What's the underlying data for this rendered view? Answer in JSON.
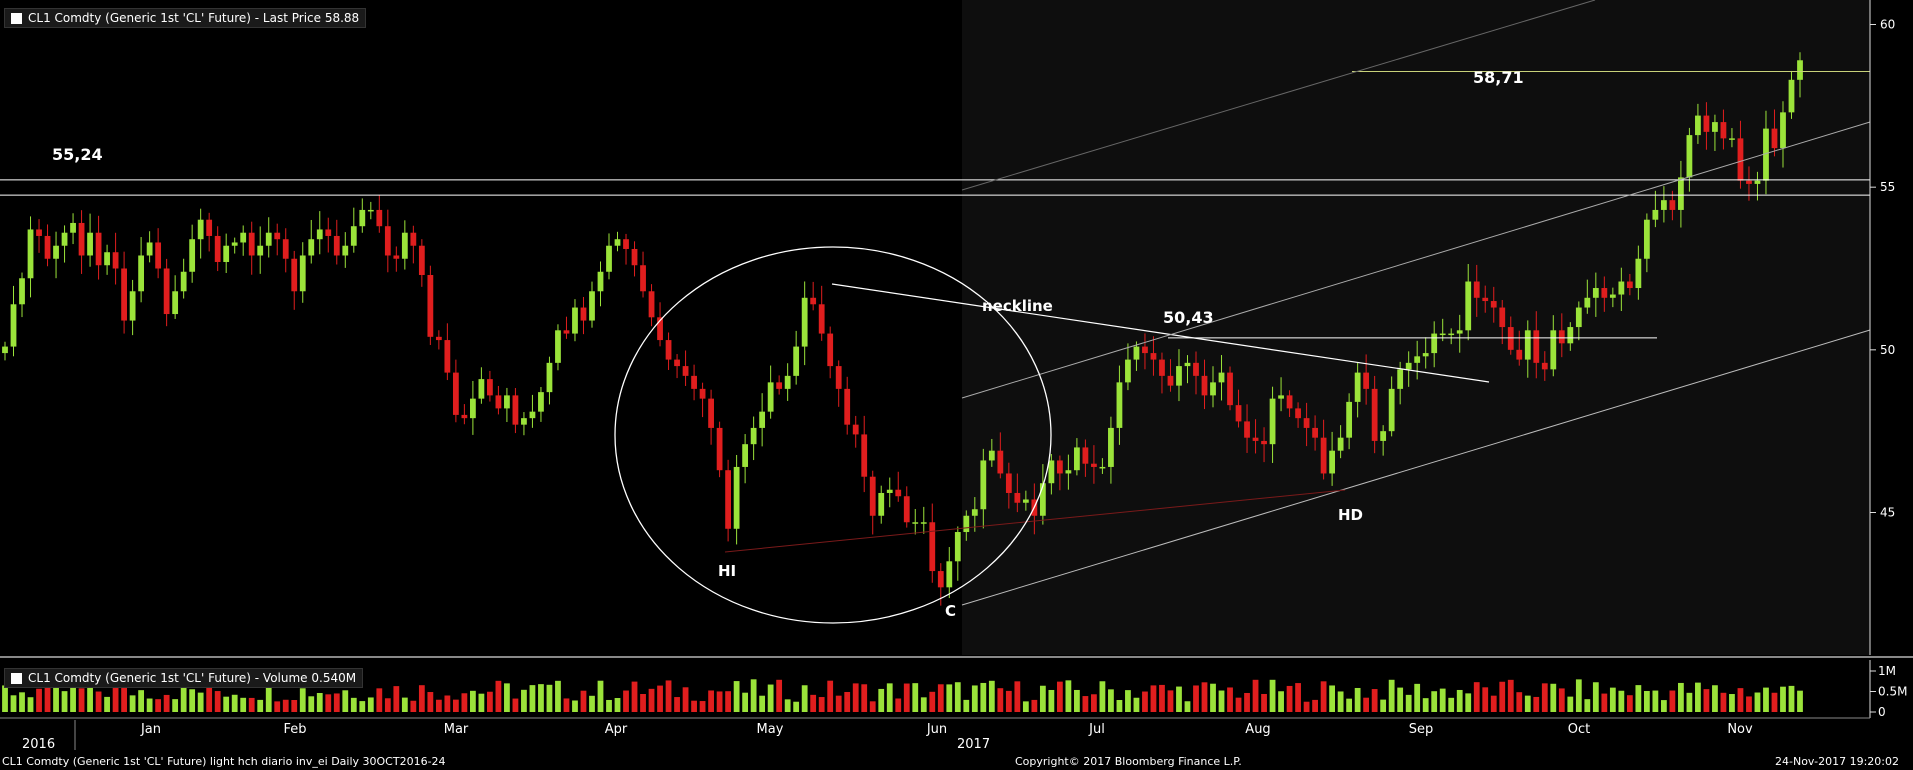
{
  "window": {
    "price_legend": "CL1 Comdty (Generic 1st 'CL' Future) - Last Price 58.88",
    "volume_legend": "CL1 Comdty (Generic 1st 'CL' Future) - Volume 0.540M",
    "footer_left": "CL1 Comdty (Generic 1st 'CL' Future) light hch diario inv_ei  Daily 30OCT2016-24",
    "footer_center": "Copyright© 2017 Bloomberg Finance L.P.",
    "footer_right": "24-Nov-2017 19:20:02"
  },
  "colors": {
    "up": "#9be33a",
    "down": "#e01e1e",
    "background": "#000000",
    "lines": "#ffffff",
    "resistance": "#c8d27a"
  },
  "chart_data": {
    "type": "candlestick",
    "y_ticks": [
      "60",
      "55",
      "50",
      "45"
    ],
    "ylim": [
      41.5,
      60.5
    ],
    "volume_ticks": [
      "1M",
      "0.5M",
      "0"
    ],
    "x_months": [
      "Jan",
      "Feb",
      "Mar",
      "Apr",
      "May",
      "Jun",
      "Jul",
      "Aug",
      "Sep",
      "Oct",
      "Nov"
    ],
    "years": [
      "2016",
      "2017"
    ],
    "closes": [
      50.1,
      51.4,
      52.2,
      53.7,
      53.5,
      52.8,
      53.2,
      53.6,
      53.9,
      52.9,
      53.6,
      52.6,
      53.0,
      52.5,
      50.9,
      51.8,
      52.9,
      53.3,
      52.5,
      51.1,
      51.8,
      52.4,
      53.4,
      54.0,
      53.5,
      52.7,
      53.2,
      53.3,
      53.6,
      52.9,
      53.2,
      53.6,
      53.4,
      52.8,
      51.8,
      52.9,
      53.4,
      53.7,
      53.5,
      52.9,
      53.2,
      53.8,
      54.3,
      54.3,
      53.8,
      52.9,
      52.8,
      53.6,
      53.2,
      52.3,
      50.4,
      50.3,
      49.3,
      48.0,
      47.9,
      48.5,
      49.1,
      48.6,
      48.2,
      48.6,
      47.7,
      47.9,
      48.1,
      48.7,
      49.6,
      50.6,
      50.5,
      51.3,
      50.9,
      51.8,
      52.4,
      53.2,
      53.4,
      53.1,
      52.6,
      51.8,
      51.0,
      50.3,
      49.7,
      49.5,
      49.2,
      48.8,
      48.5,
      47.6,
      46.3,
      44.5,
      46.4,
      47.1,
      47.6,
      48.1,
      49.0,
      48.8,
      49.2,
      50.1,
      51.6,
      51.4,
      50.5,
      49.5,
      48.8,
      47.7,
      47.4,
      46.1,
      44.9,
      45.6,
      45.7,
      45.5,
      44.7,
      44.7,
      44.7,
      43.2,
      42.7,
      43.5,
      44.4,
      44.9,
      45.1,
      46.6,
      46.9,
      46.2,
      45.6,
      45.3,
      45.4,
      44.9,
      45.9,
      46.6,
      46.2,
      46.3,
      47.0,
      46.5,
      46.4,
      46.4,
      47.6,
      49.0,
      49.7,
      50.1,
      49.9,
      49.7,
      49.2,
      48.9,
      49.5,
      49.6,
      49.2,
      48.6,
      49.0,
      49.3,
      48.3,
      47.8,
      47.3,
      47.2,
      47.1,
      48.5,
      48.6,
      48.2,
      47.9,
      47.6,
      47.3,
      46.2,
      46.9,
      47.3,
      48.4,
      49.3,
      48.8,
      47.2,
      47.5,
      48.8,
      49.4,
      49.6,
      49.8,
      49.9,
      50.5,
      50.5,
      50.5,
      50.6,
      52.1,
      51.6,
      51.5,
      51.3,
      50.7,
      50.0,
      49.7,
      50.6,
      49.6,
      49.4,
      50.6,
      50.2,
      50.7,
      51.3,
      51.6,
      51.9,
      51.6,
      51.7,
      52.1,
      51.9,
      52.8,
      54.0,
      54.3,
      54.6,
      54.3,
      55.3,
      56.6,
      57.2,
      56.7,
      57.0,
      56.5,
      56.5,
      55.2,
      55.1,
      55.2,
      56.8,
      56.2,
      57.3,
      58.3,
      58.9
    ],
    "annotations": {
      "high_2017": "55,24",
      "peak_neckline": "50,43",
      "recent_high": "58,71",
      "neckline": "neckline",
      "left_shoulder": "HI",
      "head": "C",
      "right_shoulder": "HD"
    },
    "levels": [
      55.24,
      55.0,
      50.43,
      58.71
    ],
    "grid": false,
    "legend_position": "top-left"
  }
}
